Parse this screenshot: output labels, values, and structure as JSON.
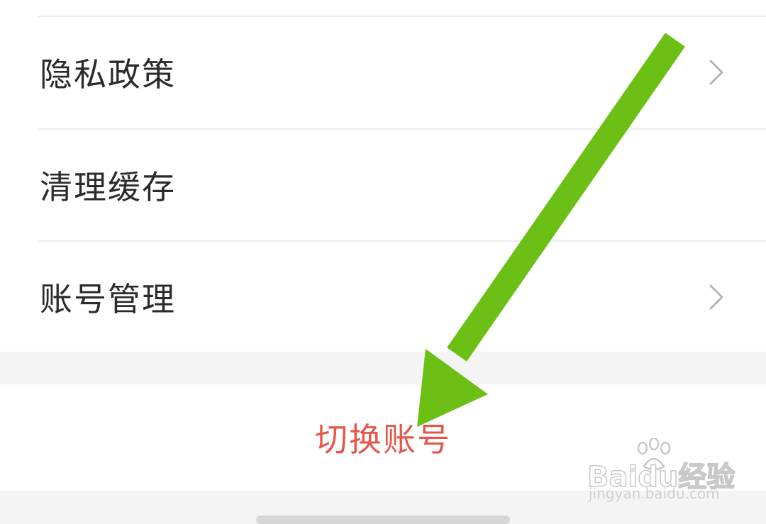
{
  "menu": {
    "items": [
      {
        "label": "隐私政策",
        "has_chevron": true
      },
      {
        "label": "清理缓存",
        "has_chevron": false
      },
      {
        "label": "账号管理",
        "has_chevron": true
      }
    ]
  },
  "switch_account": {
    "label": "切换账号",
    "color": "#e4574a"
  },
  "annotation": {
    "arrow_color": "#6cbf14",
    "arrow_icon": "arrow-down-left-icon"
  },
  "watermark": {
    "brand": "Baidu经验",
    "site": "jingyan.baidu.com"
  },
  "colors": {
    "background": "#f4f4f4",
    "card": "#ffffff",
    "text": "#2b2b2b",
    "divider": "#ececec",
    "chevron": "#b4b4b4"
  }
}
